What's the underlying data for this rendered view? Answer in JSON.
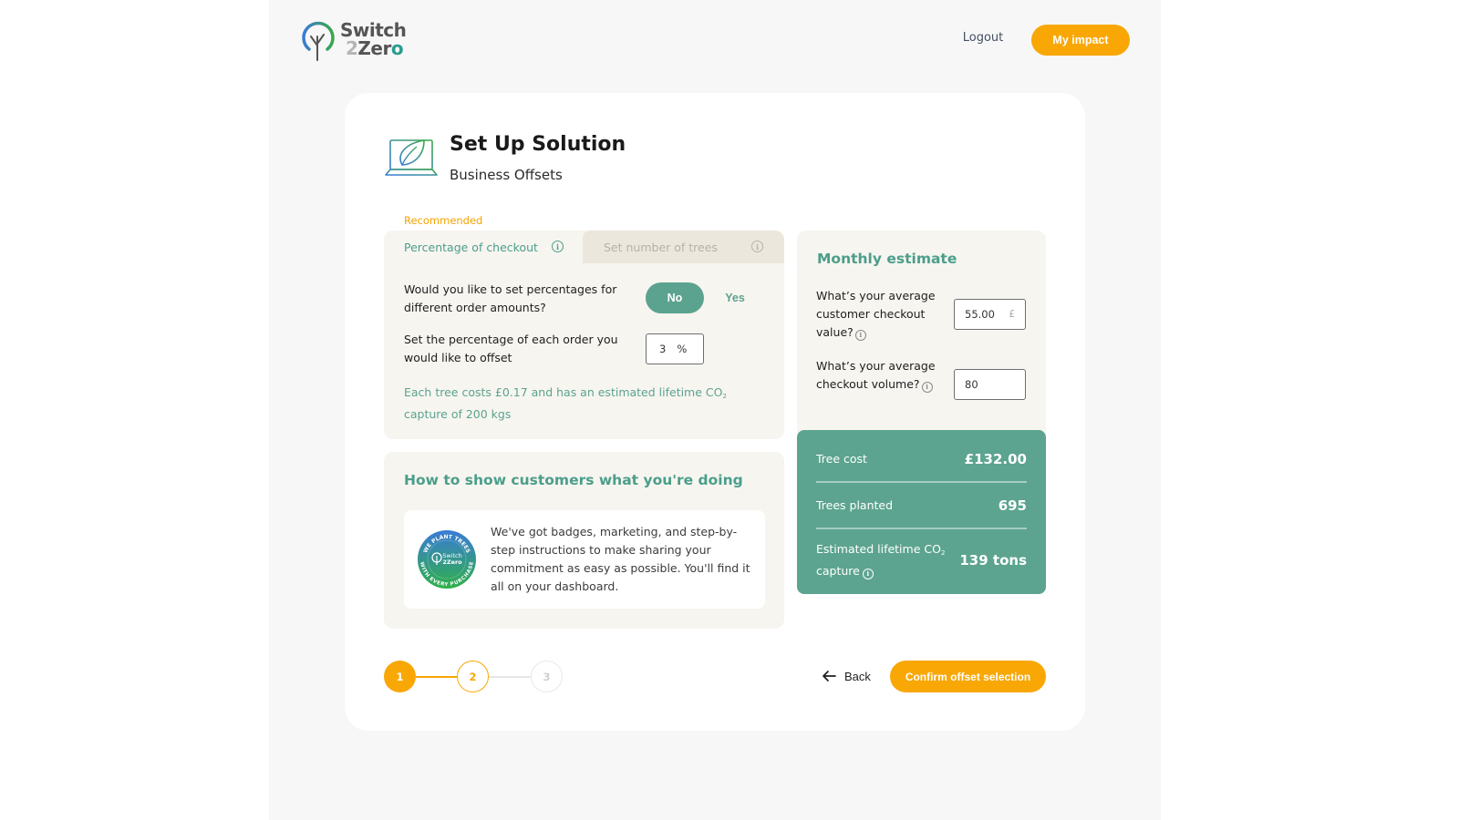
{
  "header": {
    "logo_line1": "Switch",
    "logo_line2_num": "2",
    "logo_line2_text": "Zer",
    "logo_line2_o": "o",
    "logout_label": "Logout",
    "impact_label": "My impact"
  },
  "page": {
    "title": "Set Up Solution",
    "subtitle": "Business Offsets",
    "recommended_label": "Recommended"
  },
  "tabs": [
    {
      "label": "Percentage of checkout",
      "active": true,
      "info_icon": "info-icon"
    },
    {
      "label": "Set number of trees",
      "active": false,
      "info_icon": "info-icon"
    }
  ],
  "percentage_form": {
    "question_tiers": "Would you like to set percentages for different order amounts?",
    "toggle_no": "No",
    "toggle_yes": "Yes",
    "toggle_selected": "No",
    "question_percentage": "Set the percentage of each order you would like to offset",
    "percentage_value": "3",
    "percentage_suffix": "%",
    "tree_note_prefix": "Each tree costs £0.17 and has an estimated lifetime CO",
    "tree_note_sub": "2",
    "tree_note_suffix": " capture of 200 kgs"
  },
  "show_customers": {
    "title": "How to show customers what you're doing",
    "badge_top": "WE PLANT TREES",
    "badge_bottom": "WITH EVERY PURCHASE",
    "badge_brand1": "Switch",
    "badge_brand2": "2Zero",
    "text": "We've got badges, marketing, and step-by-step instructions to make sharing your commitment as easy as possible. You'll find it all on your dashboard."
  },
  "estimate": {
    "title": "Monthly estimate",
    "checkout_value_label": "What’s your average customer checkout value?",
    "checkout_value": "55.00",
    "checkout_value_suffix": "£",
    "checkout_volume_label": "What’s your average checkout volume?",
    "checkout_volume": "80"
  },
  "results": {
    "tree_cost_label": "Tree cost",
    "tree_cost_value": "£132.00",
    "trees_planted_label": "Trees planted",
    "trees_planted_value": "695",
    "co2_label_prefix": "Estimated lifetime CO",
    "co2_label_sub": "2",
    "co2_label_suffix": "capture",
    "co2_value": "139 tons"
  },
  "stepper": {
    "steps": [
      "1",
      "2",
      "3"
    ],
    "current_step": 1
  },
  "footer": {
    "back_label": "Back",
    "confirm_label": "Confirm offset selection"
  },
  "colors": {
    "accent_orange": "#f8a705",
    "brand_green": "#5ca48f",
    "panel_bg": "#f7f5f0",
    "tab_inactive_bg": "#ece7dc"
  }
}
